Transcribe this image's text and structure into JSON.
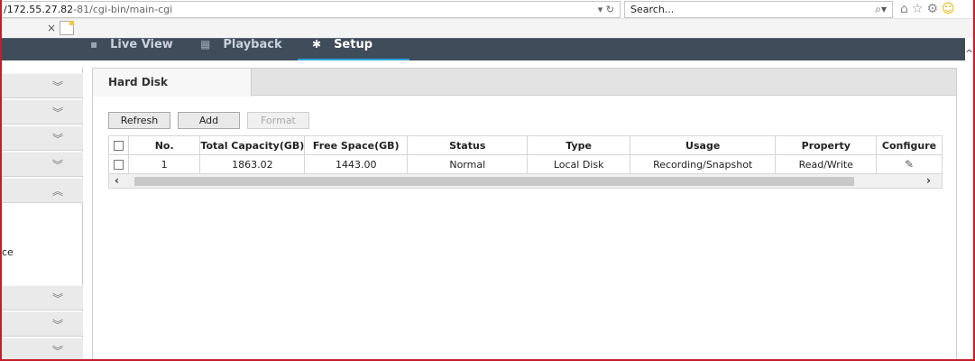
{
  "browser": {
    "url_host": "/172.55.27.82",
    "url_rest": "-81/cgi-bin/main-cgi",
    "url_controls": "▾ ↻",
    "search_placeholder": "Search...",
    "search_icon": "⌕▾",
    "toolbar_icons": [
      "home-icon",
      "star-icon",
      "gear-icon",
      "smiley-icon"
    ],
    "tab_close": "×"
  },
  "nav": {
    "live_view": "Live View",
    "playback": "Playback",
    "setup": "Setup",
    "active": "Setup",
    "accent_color": "#2e9fd8"
  },
  "sidebar": {
    "partial_text": "ce",
    "groups": [
      "collapsed",
      "collapsed",
      "collapsed",
      "collapsed",
      "expanded",
      "collapsed",
      "collapsed",
      "collapsed"
    ]
  },
  "panel": {
    "tab_title": "Hard Disk",
    "buttons": {
      "refresh": "Refresh",
      "add": "Add",
      "format": "Format"
    }
  },
  "table": {
    "headers": [
      "No.",
      "Total Capacity(GB)",
      "Free Space(GB)",
      "Status",
      "Type",
      "Usage",
      "Property",
      "Configure"
    ],
    "rows": [
      {
        "no": "1",
        "total_capacity": "1863.02",
        "free_space": "1443.00",
        "status": "Normal",
        "type": "Local Disk",
        "usage": "Recording/Snapshot",
        "property": "Read/Write"
      }
    ]
  }
}
